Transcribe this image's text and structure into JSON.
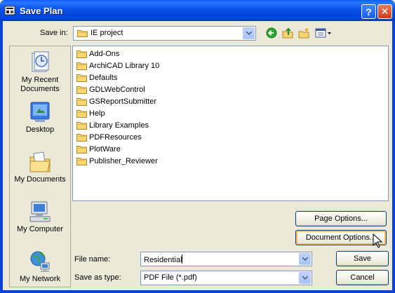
{
  "window": {
    "title": "Save Plan",
    "help_label": "?",
    "close_label": "✕"
  },
  "save_in": {
    "label": "Save in:",
    "value": "IE project"
  },
  "places": [
    {
      "label": "My Recent Documents",
      "icon": "recent-documents-icon"
    },
    {
      "label": "Desktop",
      "icon": "desktop-icon"
    },
    {
      "label": "My Documents",
      "icon": "my-documents-icon"
    },
    {
      "label": "My Computer",
      "icon": "my-computer-icon"
    },
    {
      "label": "My Network",
      "icon": "my-network-icon"
    }
  ],
  "files": [
    "Add-Ons",
    "ArchiCAD Library 10",
    "Defaults",
    "GDLWebControl",
    "GSReportSubmitter",
    "Help",
    "Library Examples",
    "PDFResources",
    "PlotWare",
    "Publisher_Reviewer"
  ],
  "buttons": {
    "page_options": "Page Options...",
    "document_options": "Document Options...",
    "save": "Save",
    "cancel": "Cancel"
  },
  "file_name": {
    "label": "File name:",
    "value": "Residential"
  },
  "save_as_type": {
    "label": "Save as type:",
    "value": "PDF File (*.pdf)"
  },
  "colors": {
    "titlebar": "#0054e3",
    "dialog_bg": "#ece9d8",
    "folder_yellow": "#f7d774"
  }
}
